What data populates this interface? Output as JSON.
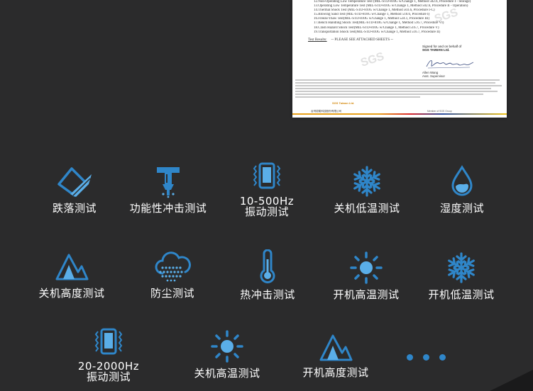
{
  "certificate": {
    "tests": [
      "12.Non-Operating Low Temperature Test (MIL-STD-810G w/Change 1, Method 502.6, Procedure I - Storage)",
      "13.Operating Low Temperature Test (MIL-STD-810G w/Change 1, Method 502.6, Procedure II - Operation)",
      "14.Thermal Shock Test (MIL-STD-810G w/Change 1, Method 503.6, Procedure I-C)",
      "15.Blowing Sand Test (MIL-STD-810G w/Change 1, Method 510.6, Procedure I)",
      "16.Freeze/Thaw Test(MIL-STD-810G w/Change 1, Method 524.1, Procedure III)",
      "17.Bench Handling Shock Test(MIL-STD-810G w/Change 1, Method 516.7, Procedure VI)",
      "18.Crash Hazard Shock Test(MIL-STD-810G w/Change 1, Method 516.7, Procedure V)",
      "19.Transportation Shock Test(MIL-STD-810G w/Change 1, Method 516.7, Procedure II)"
    ],
    "results_label": "Test Results:",
    "results_value": "-- PLEASE SEE ATTACHED SHEETS --",
    "signed_line1": "Signed for and on behalf of",
    "signed_line2": "SGS TAIWAN Ltd.",
    "signer_name": "Allen Wang",
    "signer_title": "Asst. Supervisor",
    "watermark": "SGS",
    "footer_logo": "SGS Taiwan Ltd.",
    "footer_company": "台灣檢驗科技股份有限公司",
    "footer_member": "Member of SGS Group"
  },
  "features": [
    {
      "label": "跌落测试",
      "icon": "drop-test-icon"
    },
    {
      "label": "功能性冲击测试",
      "icon": "functional-shock-icon"
    },
    {
      "label": "10-500Hz",
      "label2": "振动测试",
      "icon": "vibration-icon"
    },
    {
      "label": "关机低温测试",
      "icon": "snowflake-icon"
    },
    {
      "label": "湿度测试",
      "icon": "water-drop-icon"
    },
    {
      "label": "关机高度测试",
      "icon": "mountain-icon"
    },
    {
      "label": "防尘测试",
      "icon": "dust-cloud-icon"
    },
    {
      "label": "热冲击测试",
      "icon": "thermometer-icon"
    },
    {
      "label": "开机高温测试",
      "icon": "sun-icon"
    },
    {
      "label": "开机低温测试",
      "icon": "snowflake-icon"
    },
    {
      "label": "20-2000Hz",
      "label2": "振动测试",
      "icon": "vibration-icon"
    },
    {
      "label": "关机高温测试",
      "icon": "sun-icon"
    },
    {
      "label": "开机高度测试",
      "icon": "mountain-icon"
    }
  ],
  "colors": {
    "background": "#2b2b2c",
    "icon_blue": "#2f86c9",
    "icon_light_blue": "#5aaee8",
    "text": "#ffffff"
  }
}
